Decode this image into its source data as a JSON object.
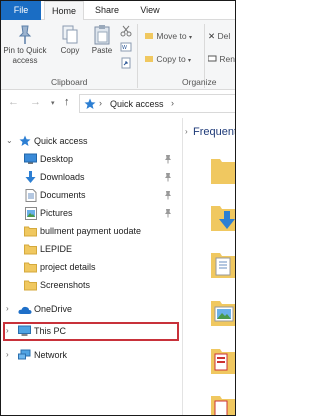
{
  "ribbon_tabs": {
    "file": "File",
    "home": "Home",
    "share": "Share",
    "view": "View"
  },
  "ribbon": {
    "pin_label_1": "Pin to Quick",
    "pin_label_2": "access",
    "copy": "Copy",
    "paste": "Paste",
    "move_to": "Move to",
    "copy_to": "Copy to",
    "delete": "Del",
    "rename": "Ren",
    "clipboard_group": "Clipboard",
    "organize_group": "Organize"
  },
  "address": {
    "path": "Quick access"
  },
  "nav": {
    "quick_access": "Quick access",
    "items": [
      {
        "label": "Desktop",
        "icon": "desktop-icon",
        "pinned": true
      },
      {
        "label": "Downloads",
        "icon": "downloads-icon",
        "pinned": true
      },
      {
        "label": "Documents",
        "icon": "documents-icon",
        "pinned": true
      },
      {
        "label": "Pictures",
        "icon": "pictures-icon",
        "pinned": true
      },
      {
        "label": "bullment payment uodate",
        "icon": "folder-icon",
        "pinned": false
      },
      {
        "label": "LEPIDE",
        "icon": "folder-icon",
        "pinned": false
      },
      {
        "label": "project details",
        "icon": "folder-icon",
        "pinned": false
      },
      {
        "label": "Screenshots",
        "icon": "folder-icon",
        "pinned": false
      }
    ],
    "onedrive": "OneDrive",
    "this_pc": "This PC",
    "network": "Network"
  },
  "content": {
    "title": "Frequent"
  },
  "colors": {
    "accent": "#1a6dc4",
    "folder": "#f0c860",
    "highlight_border": "#c8313a"
  }
}
